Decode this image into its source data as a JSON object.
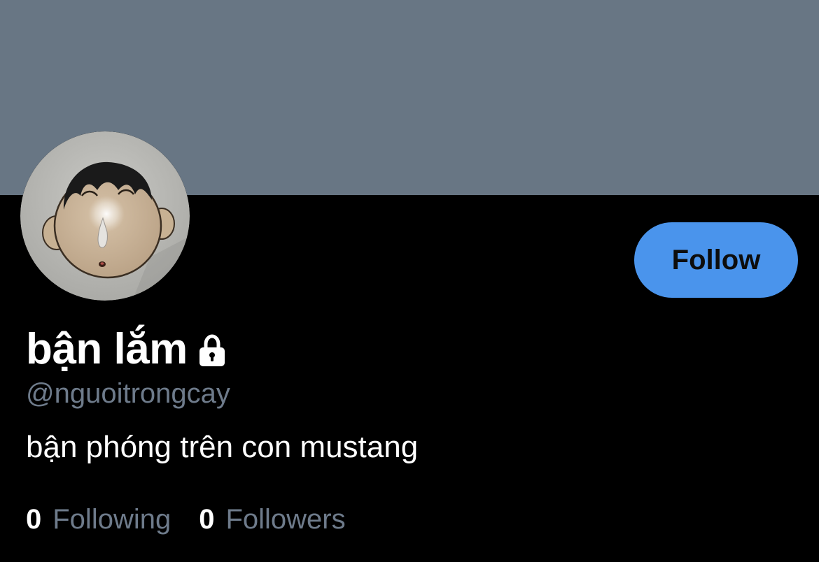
{
  "profile": {
    "display_name": "bận lắm",
    "handle": "@nguoitrongcay",
    "bio": "bận phóng trên con mustang",
    "protected_icon": "lock-icon",
    "avatar_icon": "cartoon-face-avatar"
  },
  "actions": {
    "follow_label": "Follow"
  },
  "stats": {
    "following_count": "0",
    "following_label": "Following",
    "followers_count": "0",
    "followers_label": "Followers"
  },
  "colors": {
    "banner": "#687684",
    "background": "#000000",
    "follow_button": "#4a94ec",
    "secondary_text": "#6e7b8b",
    "primary_text": "#ffffff"
  }
}
